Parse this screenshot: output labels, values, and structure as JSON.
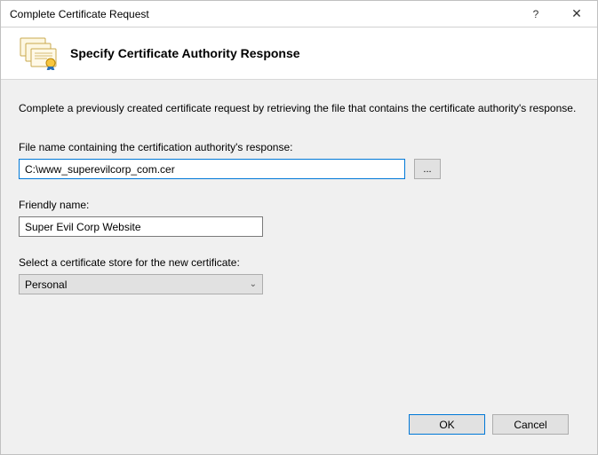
{
  "window": {
    "title": "Complete Certificate Request",
    "help_symbol": "?",
    "close_symbol": "✕"
  },
  "header": {
    "heading": "Specify Certificate Authority Response"
  },
  "body": {
    "intro": "Complete a previously created certificate request by retrieving the file that contains the certificate authority's response.",
    "file_label": "File name containing the certification authority's response:",
    "file_value": "C:\\www_superevilcorp_com.cer",
    "browse_label": "...",
    "friendly_label": "Friendly name:",
    "friendly_value": "Super Evil Corp Website",
    "store_label": "Select a certificate store for the new certificate:",
    "store_value": "Personal"
  },
  "footer": {
    "ok": "OK",
    "cancel": "Cancel"
  }
}
